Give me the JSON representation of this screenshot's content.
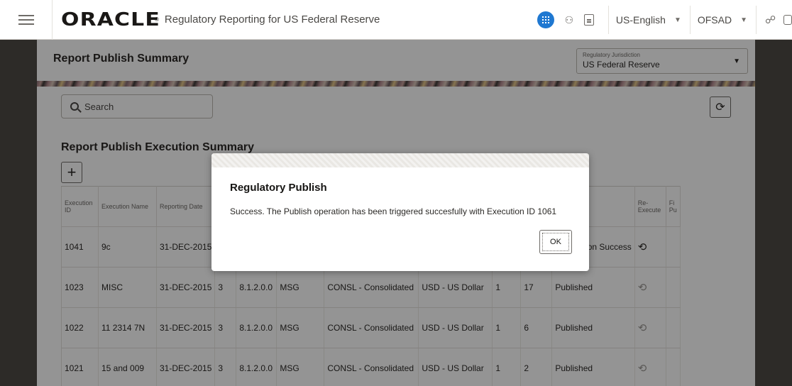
{
  "header": {
    "brand": "ORACLE",
    "app_title": "Regulatory Reporting for US Federal Reserve",
    "language": "US-English",
    "user": "OFSAD",
    "icons": [
      "menu-icon",
      "apps-icon",
      "user-icon",
      "document-icon",
      "org-icon",
      "box-icon"
    ],
    "accent_color": "#1f78d1"
  },
  "page": {
    "title": "Report Publish Summary",
    "jurisdiction_label": "Regulatory Jurisdiction",
    "jurisdiction_value": "US Federal Reserve",
    "search_placeholder": "Search",
    "section_title": "Report Publish Execution Summary",
    "add_label": "+",
    "refresh_glyph": "⟳"
  },
  "table": {
    "headers": [
      "Execution ID",
      "Execution Name",
      "Reporting Date",
      "",
      "",
      "",
      "",
      "",
      "",
      "",
      "",
      "Re-Execute",
      "Fi Pu"
    ],
    "rows": [
      [
        "1041",
        "9c",
        "31-DEC-2015",
        "",
        "",
        "",
        "",
        "",
        "",
        "",
        "Publication Success",
        "⟲",
        ""
      ],
      [
        "1023",
        "MISC",
        "31-DEC-2015",
        "3",
        "8.1.2.0.0",
        "MSG",
        "CONSL - Consolidated",
        "USD - US Dollar",
        "1",
        "17",
        "Published",
        "⟲",
        ""
      ],
      [
        "1022",
        "11 2314 7N",
        "31-DEC-2015",
        "3",
        "8.1.2.0.0",
        "MSG",
        "CONSL - Consolidated",
        "USD - US Dollar",
        "1",
        "6",
        "Published",
        "⟲",
        ""
      ],
      [
        "1021",
        "15 and 009",
        "31-DEC-2015",
        "3",
        "8.1.2.0.0",
        "MSG",
        "CONSL - Consolidated",
        "USD - US Dollar",
        "1",
        "2",
        "Published",
        "⟲",
        ""
      ]
    ]
  },
  "dialog": {
    "title": "Regulatory Publish",
    "message": "Success. The Publish operation has been triggered succesfully with Execution ID 1061",
    "ok_label": "OK"
  }
}
